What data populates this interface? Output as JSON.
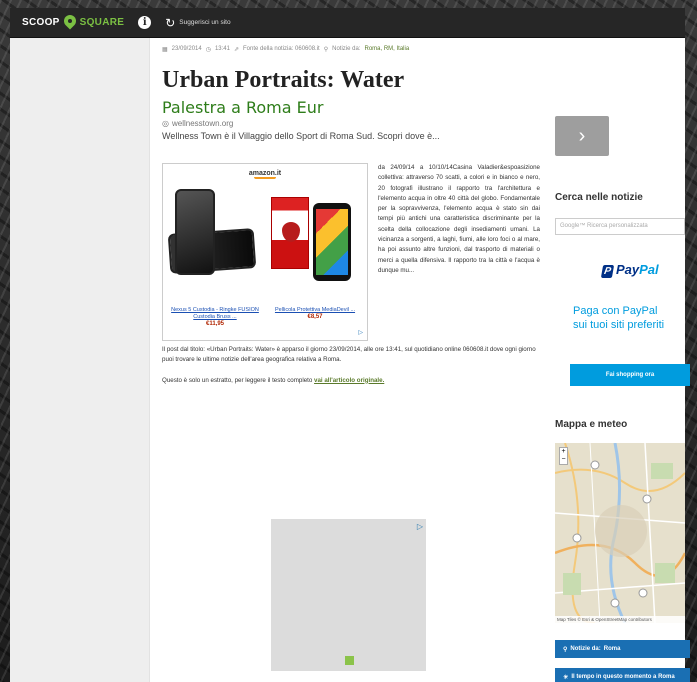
{
  "navbar": {
    "brand_scoop": "SCOOP",
    "brand_square": "SQUARE",
    "info_icon": "i",
    "suggest_label": "Suggerisci un sito"
  },
  "article": {
    "meta_date": "23/09/2014",
    "meta_time": "13:41",
    "meta_source": "Fonte della notizia: 060608.it",
    "meta_location_prefix": "Notizie da:",
    "meta_location": "Roma, RM, Italia",
    "title": "Urban Portraits: Water",
    "ad": {
      "headline": "Palestra a Roma Eur",
      "url": "wellnesstown.org",
      "description": "Wellness Town è il Villaggio dello Sport di Roma Sud. Scopri dove è..."
    },
    "amazon": {
      "logo": "amazon.it",
      "product_1_title": "Nexus 5 Custodia - Ringke FUSION Custodia Bruss ...",
      "product_1_price": "€11,95",
      "product_2_title": "Pellicola Protettiva MediaDevil ...",
      "product_2_price": "€8,57",
      "adchoices": "▷"
    },
    "body_text": "da 24/09/14 a 10/10/14Casina Valadier&espoasizione collettiva: attraverso 70 scatti, a colori e in bianco e nero, 20 fotografi illustrano il rapporto tra l'architettura e l'elemento acqua in oltre 40 città del globo. Fondamentale per la sopravvivenza, l'elemento acqua è stato sin dai tempi più antichi una caratteristica discriminante per la scelta della collocazione degli insediamenti umani. La vicinanza a sorgenti, a laghi, fiumi, alle loro foci o al mare, ha poi assunto altre funzioni, dal trasporto di materiali o merci a quella difensiva. Il rapporto tra la città e l'acqua è dunque mu...",
    "post_para_1": "Il post dal titolo: «Urban Portraits: Water» è apparso il giorno 23/09/2014, alle ore 13:41, sul quotidiano online 060608.it dove ogni giorno puoi trovare le ultime notizie dell'area geografica relativa a Roma.",
    "post_para_2_prefix": "Questo è solo un estratto, per leggere il testo completo",
    "post_para_2_link": "vai all'articolo originale.",
    "gray_ad_choice": "▷"
  },
  "sidebar": {
    "next_icon": "›",
    "search_heading": "Cerca nelle notizie",
    "search_placeholder": "Google™ Ricerca personalizzata",
    "paypal": {
      "logo_a": "Pay",
      "logo_b": "Pal",
      "tagline_1": "Paga con PayPal",
      "tagline_2": "sui tuoi siti preferiti",
      "button": "Fai shopping ora"
    },
    "map_heading": "Mappa e meteo",
    "map_attribution": "Map Tiles © Esri & OpenStreetMap contributors",
    "news_button_prefix": "Notizie da:",
    "news_button_place": "Roma",
    "weather_button": "Il tempo in questo momento a Roma"
  }
}
